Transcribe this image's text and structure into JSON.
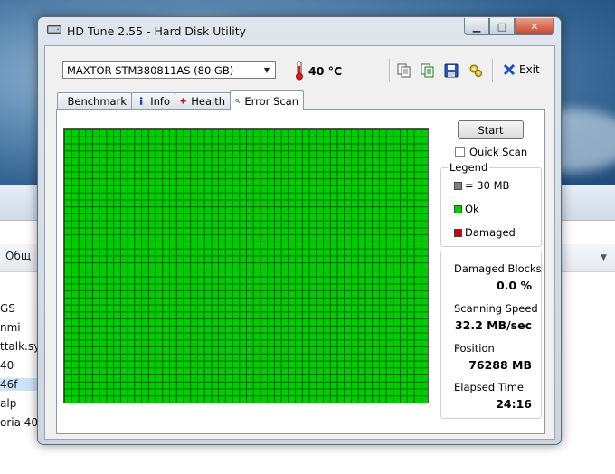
{
  "window": {
    "title": "HD Tune 2.55 - Hard Disk Utility"
  },
  "toolbar": {
    "drive": "MAXTOR STM380811AS (80 GB)",
    "temperature": "40 °C",
    "exit_label": "Exit"
  },
  "tabs": [
    {
      "label": "Benchmark"
    },
    {
      "label": "Info"
    },
    {
      "label": "Health"
    },
    {
      "label": "Error Scan"
    }
  ],
  "scan": {
    "start_label": "Start",
    "quick_scan_label": "Quick Scan",
    "quick_scan_checked": false,
    "grid_columns": 52,
    "grid_rows": 39,
    "block_color": "#00cc00",
    "grid_line_color": "#006b00"
  },
  "legend": {
    "title": "Legend",
    "items": [
      {
        "label": "= 30 MB",
        "color": "#7f7f7f"
      },
      {
        "label": "Ok",
        "color": "#00cc00"
      },
      {
        "label": "Damaged",
        "color": "#d40000"
      }
    ]
  },
  "stats": {
    "damaged_blocks_label": "Damaged Blocks",
    "damaged_blocks_value": "0.0 %",
    "speed_label": "Scanning Speed",
    "speed_value": "32.2 MB/sec",
    "position_label": "Position",
    "position_value": "76288 MB",
    "elapsed_label": "Elapsed Time",
    "elapsed_value": "24:16"
  },
  "background": {
    "tab_label": "Общ",
    "list": [
      "GS",
      "nmi",
      "ttalk.sys",
      "40",
      "46f",
      "alp",
      "oria 40 \\"
    ]
  }
}
